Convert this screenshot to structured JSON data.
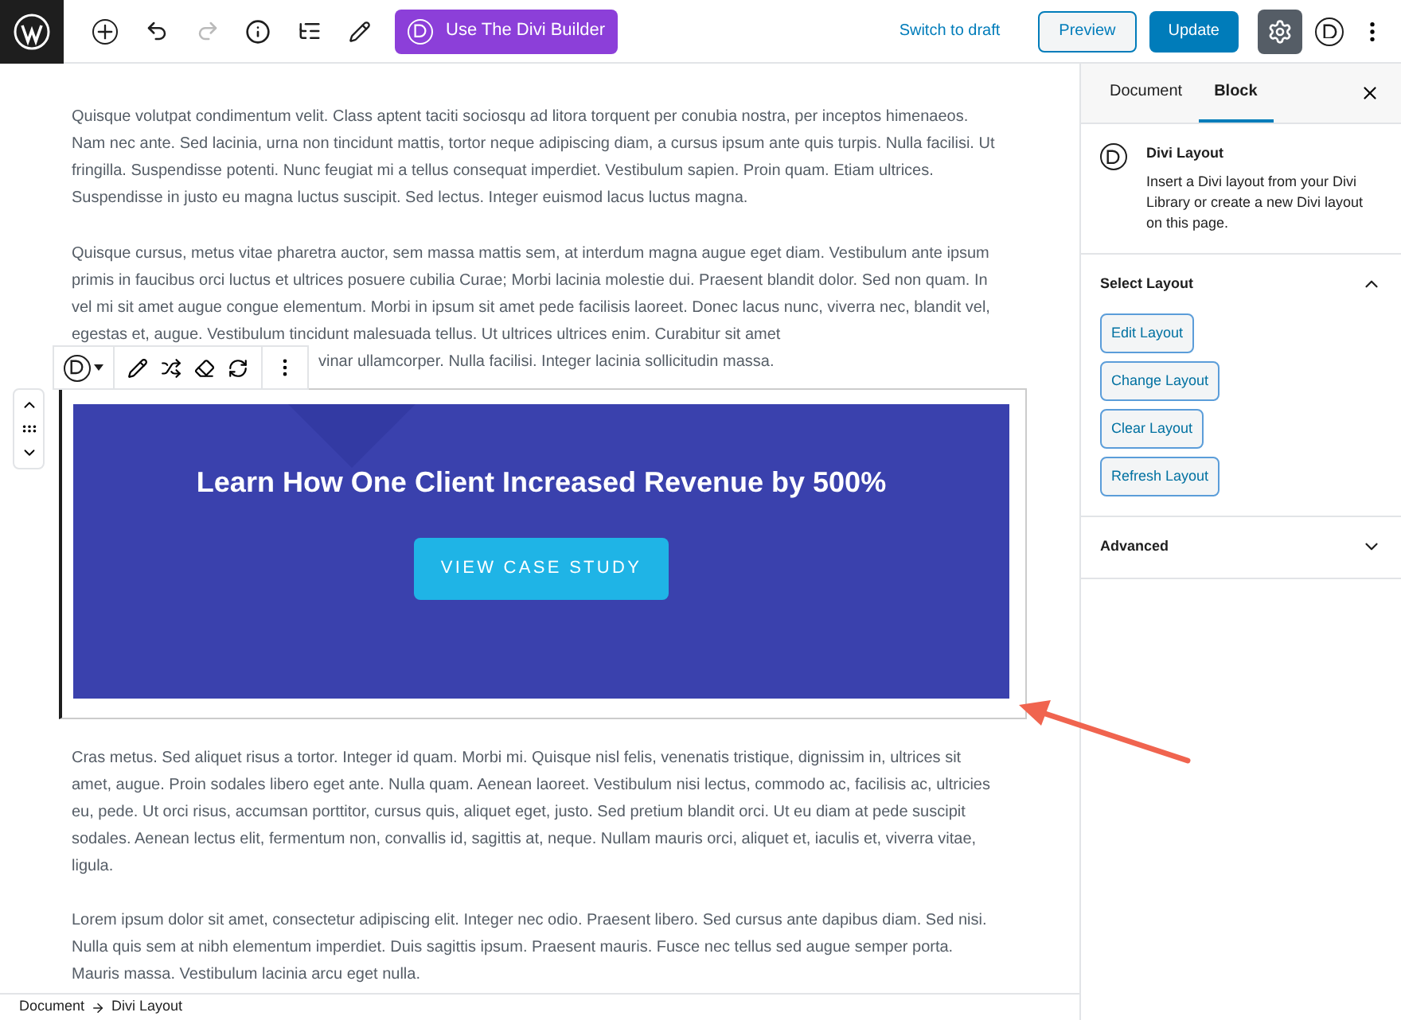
{
  "top_bar": {
    "redo_disabled": true,
    "divi_button": "Use The Divi Builder",
    "switch_to_draft": "Switch to draft",
    "preview": "Preview",
    "update": "Update",
    "settings_active": true
  },
  "content": {
    "paragraphs": [
      {
        "text": "Quisque volutpat condimentum velit. Class aptent taciti sociosqu ad litora torquent per conubia nostra, per inceptos himenaeos. Nam nec ante. Sed lacinia, urna non tincidunt mattis, tortor neque adipiscing diam, a cursus ipsum ante quis turpis. Nulla facilisi. Ut fringilla. Suspendisse potenti. Nunc feugiat mi a tellus consequat imperdiet. Vestibulum sapien. Proin quam. Etiam ultrices. Suspendisse in justo eu magna luctus suscipit. Sed lectus. Integer euismod lacus luctus magna."
      },
      {
        "text": "Quisque cursus, metus vitae pharetra auctor, sem massa mattis sem, at interdum magna augue eget diam. Vestibulum ante ipsum primis in faucibus orci luctus et ultrices posuere cubilia Curae; Morbi lacinia molestie dui. Praesent blandit dolor. Sed non quam. In vel mi sit amet augue congue elementum. Morbi in ipsum sit amet pede facilisis laoreet. Donec lacus nunc, viverra nec, blandit vel, egestas et, augue. Vestibulum tincidunt malesuada tellus. Ut ultrices ultrices enim. Curabitur sit amet",
        "tail": "vinar ullamcorper. Nulla facilisi. Integer lacinia sollicitudin massa."
      }
    ],
    "divi_block": {
      "heading": "Learn How One Client Increased Revenue by 500%",
      "button": "VIEW CASE STUDY"
    },
    "paragraphs_after": [
      {
        "text": "Cras metus. Sed aliquet risus a tortor. Integer id quam. Morbi mi. Quisque nisl felis, venenatis tristique, dignissim in, ultrices sit amet, augue. Proin sodales libero eget ante. Nulla quam. Aenean laoreet. Vestibulum nisi lectus, commodo ac, facilisis ac, ultricies eu, pede. Ut orci risus, accumsan porttitor, cursus quis, aliquet eget, justo. Sed pretium blandit orci. Ut eu diam at pede suscipit sodales. Aenean lectus elit, fermentum non, convallis id, sagittis at, neque. Nullam mauris orci, aliquet et, iaculis et, viverra vitae, ligula."
      },
      {
        "text": "Lorem ipsum dolor sit amet, consectetur adipiscing elit. Integer nec odio. Praesent libero. Sed cursus ante dapibus diam. Sed nisi. Nulla quis sem at nibh elementum imperdiet. Duis sagittis ipsum. Praesent mauris. Fusce nec tellus sed augue semper porta. Mauris massa. Vestibulum lacinia arcu eget nulla."
      }
    ]
  },
  "sidebar": {
    "tabs": [
      {
        "label": "Document",
        "selected": false
      },
      {
        "label": "Block",
        "selected": true
      }
    ],
    "block_card": {
      "title": "Divi Layout",
      "description": "Insert a Divi layout from your Divi Library or create a new Divi layout on this page."
    },
    "panels": [
      {
        "title": "Select Layout",
        "expanded": true,
        "buttons": [
          "Edit Layout",
          "Change Layout",
          "Clear Layout",
          "Refresh Layout"
        ]
      },
      {
        "title": "Advanced",
        "expanded": false
      }
    ]
  },
  "breadcrumb": [
    "Document",
    "Divi Layout"
  ]
}
